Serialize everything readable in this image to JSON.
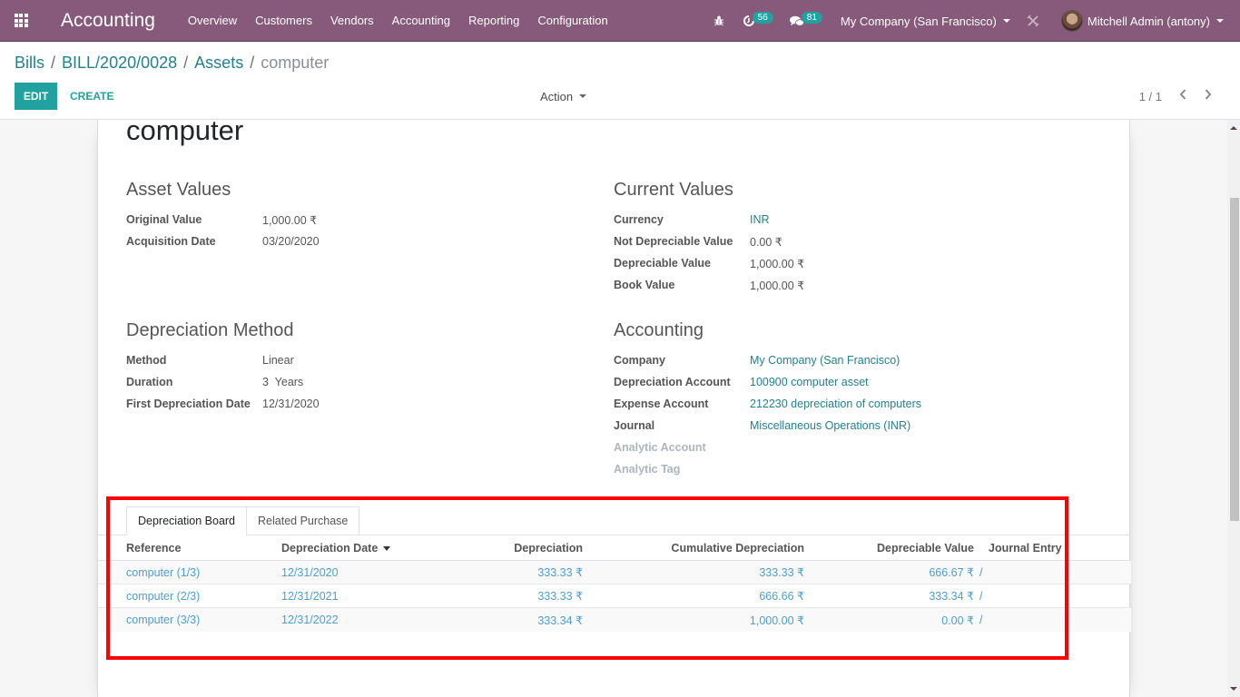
{
  "navbar": {
    "app_title": "Accounting",
    "menu": [
      "Overview",
      "Customers",
      "Vendors",
      "Accounting",
      "Reporting",
      "Configuration"
    ],
    "activities_count": "56",
    "messages_count": "81",
    "company": "My Company (San Francisco)",
    "user": "Mitchell Admin (antony)",
    "colors": {
      "navbar_bg": "#875a7b",
      "badge": "#21a1a0"
    }
  },
  "breadcrumb": {
    "items": [
      "Bills",
      "BILL/2020/0028",
      "Assets"
    ],
    "separator": "/",
    "current": "computer"
  },
  "controls": {
    "edit_label": "EDIT",
    "create_label": "CREATE",
    "action_label": "Action",
    "pager": "1 / 1"
  },
  "record": {
    "title": "computer",
    "asset_values": {
      "title": "Asset Values",
      "fields": [
        {
          "label": "Original Value",
          "value": "1,000.00 ₹"
        },
        {
          "label": "Acquisition Date",
          "value": "03/20/2020"
        }
      ]
    },
    "current_values": {
      "title": "Current Values",
      "fields": [
        {
          "label": "Currency",
          "value": "INR"
        },
        {
          "label": "Not Depreciable Value",
          "value": "0.00 ₹"
        },
        {
          "label": "Depreciable Value",
          "value": "1,000.00 ₹"
        },
        {
          "label": "Book Value",
          "value": "1,000.00 ₹"
        }
      ]
    },
    "depreciation_method": {
      "title": "Depreciation Method",
      "fields": [
        {
          "label": "Method",
          "value": "Linear"
        },
        {
          "label": "Duration",
          "value": "3  Years"
        },
        {
          "label": "First Depreciation Date",
          "value": "12/31/2020"
        }
      ]
    },
    "accounting": {
      "title": "Accounting",
      "fields": [
        {
          "label": "Company",
          "value": "My Company (San Francisco)"
        },
        {
          "label": "Depreciation Account",
          "value": "100900 computer asset"
        },
        {
          "label": "Expense Account",
          "value": "212230 depreciation of computers"
        },
        {
          "label": "Journal",
          "value": "Miscellaneous Operations (INR)"
        },
        {
          "label": "Analytic Account",
          "value": ""
        },
        {
          "label": "Analytic Tag",
          "value": ""
        }
      ]
    }
  },
  "tabs": [
    "Depreciation Board",
    "Related Purchase"
  ],
  "depreciation_table": {
    "columns": [
      "Reference",
      "Depreciation Date",
      "Depreciation",
      "Cumulative Depreciation",
      "Depreciable Value",
      "Journal Entry"
    ],
    "rows": [
      {
        "reference": "computer (1/3)",
        "date": "12/31/2020",
        "depreciation": "333.33 ₹",
        "cumulative": "333.33 ₹",
        "depreciable": "666.67 ₹",
        "journal_entry": "/"
      },
      {
        "reference": "computer (2/3)",
        "date": "12/31/2021",
        "depreciation": "333.33 ₹",
        "cumulative": "666.66 ₹",
        "depreciable": "333.34 ₹",
        "journal_entry": "/"
      },
      {
        "reference": "computer (3/3)",
        "date": "12/31/2022",
        "depreciation": "333.34 ₹",
        "cumulative": "1,000.00 ₹",
        "depreciable": "0.00 ₹",
        "journal_entry": "/"
      }
    ]
  }
}
